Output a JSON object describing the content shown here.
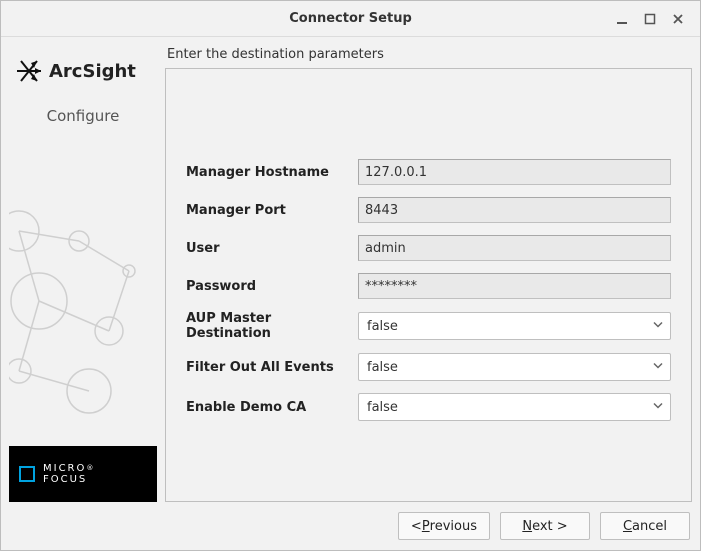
{
  "window": {
    "title": "Connector Setup"
  },
  "sidebar": {
    "brand": "ArcSight",
    "step": "Configure",
    "footer_line1": "MICRO",
    "footer_line2": "FOCUS"
  },
  "content": {
    "instruction": "Enter the destination parameters"
  },
  "form": {
    "mgr_host": {
      "label": "Manager Hostname",
      "value": "127.0.0.1"
    },
    "mgr_port": {
      "label": "Manager Port",
      "value": "8443"
    },
    "user": {
      "label": "User",
      "value": "admin"
    },
    "password": {
      "label": "Password",
      "value": "********"
    },
    "aup": {
      "label": "AUP Master Destination",
      "value": "false"
    },
    "filter": {
      "label": "Filter Out All Events",
      "value": "false"
    },
    "demo_ca": {
      "label": "Enable Demo CA",
      "value": "false"
    }
  },
  "buttons": {
    "prev": {
      "pre": "< ",
      "accel": "P",
      "rest": "revious"
    },
    "next": {
      "accel": "N",
      "rest": "ext >"
    },
    "cancel": {
      "accel": "C",
      "rest": "ancel"
    }
  }
}
